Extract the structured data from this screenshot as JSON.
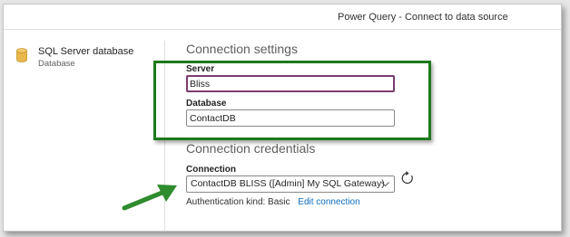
{
  "window": {
    "title": "Power Query - Connect to data source"
  },
  "source": {
    "name": "SQL Server database",
    "type": "Database",
    "icon": "database-icon"
  },
  "settings": {
    "heading": "Connection settings",
    "server_label": "Server",
    "server_value": "Bliss",
    "database_label": "Database",
    "database_value": "ContactDB"
  },
  "credentials": {
    "heading": "Connection credentials",
    "connection_label": "Connection",
    "connection_value": "ContactDB BLISS ([Admin] My SQL Gateway)",
    "auth_label": "Authentication kind: Basic",
    "edit_link": "Edit connection"
  },
  "colors": {
    "highlight": "#1d7a1d",
    "focus_border": "#7a3b6f",
    "link": "#0f6cbd",
    "arrow": "#2e8b2e",
    "db_icon": "#e8b84a"
  }
}
